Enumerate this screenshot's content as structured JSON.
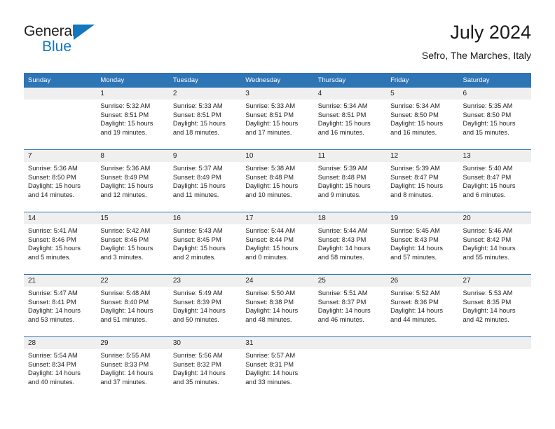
{
  "logo": {
    "primary_text": "General",
    "secondary_text": "Blue",
    "triangle_icon": "blue-triangle-icon",
    "primary_color": "#231f20",
    "accent_color": "#1277bc"
  },
  "header": {
    "title": "July 2024",
    "subtitle": "Sefro, The Marches, Italy"
  },
  "theme": {
    "header_blue": "#2e75b6",
    "day_band_gray": "#efefef",
    "text_color": "#222222"
  },
  "calendar": {
    "weekday_headers": [
      "Sunday",
      "Monday",
      "Tuesday",
      "Wednesday",
      "Thursday",
      "Friday",
      "Saturday"
    ],
    "weeks": [
      [
        {
          "day": "",
          "empty": true
        },
        {
          "day": "1",
          "sunrise": "Sunrise: 5:32 AM",
          "sunset": "Sunset: 8:51 PM",
          "daylight_line1": "Daylight: 15 hours",
          "daylight_line2": "and 19 minutes."
        },
        {
          "day": "2",
          "sunrise": "Sunrise: 5:33 AM",
          "sunset": "Sunset: 8:51 PM",
          "daylight_line1": "Daylight: 15 hours",
          "daylight_line2": "and 18 minutes."
        },
        {
          "day": "3",
          "sunrise": "Sunrise: 5:33 AM",
          "sunset": "Sunset: 8:51 PM",
          "daylight_line1": "Daylight: 15 hours",
          "daylight_line2": "and 17 minutes."
        },
        {
          "day": "4",
          "sunrise": "Sunrise: 5:34 AM",
          "sunset": "Sunset: 8:51 PM",
          "daylight_line1": "Daylight: 15 hours",
          "daylight_line2": "and 16 minutes."
        },
        {
          "day": "5",
          "sunrise": "Sunrise: 5:34 AM",
          "sunset": "Sunset: 8:50 PM",
          "daylight_line1": "Daylight: 15 hours",
          "daylight_line2": "and 16 minutes."
        },
        {
          "day": "6",
          "sunrise": "Sunrise: 5:35 AM",
          "sunset": "Sunset: 8:50 PM",
          "daylight_line1": "Daylight: 15 hours",
          "daylight_line2": "and 15 minutes."
        }
      ],
      [
        {
          "day": "7",
          "sunrise": "Sunrise: 5:36 AM",
          "sunset": "Sunset: 8:50 PM",
          "daylight_line1": "Daylight: 15 hours",
          "daylight_line2": "and 14 minutes."
        },
        {
          "day": "8",
          "sunrise": "Sunrise: 5:36 AM",
          "sunset": "Sunset: 8:49 PM",
          "daylight_line1": "Daylight: 15 hours",
          "daylight_line2": "and 12 minutes."
        },
        {
          "day": "9",
          "sunrise": "Sunrise: 5:37 AM",
          "sunset": "Sunset: 8:49 PM",
          "daylight_line1": "Daylight: 15 hours",
          "daylight_line2": "and 11 minutes."
        },
        {
          "day": "10",
          "sunrise": "Sunrise: 5:38 AM",
          "sunset": "Sunset: 8:48 PM",
          "daylight_line1": "Daylight: 15 hours",
          "daylight_line2": "and 10 minutes."
        },
        {
          "day": "11",
          "sunrise": "Sunrise: 5:39 AM",
          "sunset": "Sunset: 8:48 PM",
          "daylight_line1": "Daylight: 15 hours",
          "daylight_line2": "and 9 minutes."
        },
        {
          "day": "12",
          "sunrise": "Sunrise: 5:39 AM",
          "sunset": "Sunset: 8:47 PM",
          "daylight_line1": "Daylight: 15 hours",
          "daylight_line2": "and 8 minutes."
        },
        {
          "day": "13",
          "sunrise": "Sunrise: 5:40 AM",
          "sunset": "Sunset: 8:47 PM",
          "daylight_line1": "Daylight: 15 hours",
          "daylight_line2": "and 6 minutes."
        }
      ],
      [
        {
          "day": "14",
          "sunrise": "Sunrise: 5:41 AM",
          "sunset": "Sunset: 8:46 PM",
          "daylight_line1": "Daylight: 15 hours",
          "daylight_line2": "and 5 minutes."
        },
        {
          "day": "15",
          "sunrise": "Sunrise: 5:42 AM",
          "sunset": "Sunset: 8:46 PM",
          "daylight_line1": "Daylight: 15 hours",
          "daylight_line2": "and 3 minutes."
        },
        {
          "day": "16",
          "sunrise": "Sunrise: 5:43 AM",
          "sunset": "Sunset: 8:45 PM",
          "daylight_line1": "Daylight: 15 hours",
          "daylight_line2": "and 2 minutes."
        },
        {
          "day": "17",
          "sunrise": "Sunrise: 5:44 AM",
          "sunset": "Sunset: 8:44 PM",
          "daylight_line1": "Daylight: 15 hours",
          "daylight_line2": "and 0 minutes."
        },
        {
          "day": "18",
          "sunrise": "Sunrise: 5:44 AM",
          "sunset": "Sunset: 8:43 PM",
          "daylight_line1": "Daylight: 14 hours",
          "daylight_line2": "and 58 minutes."
        },
        {
          "day": "19",
          "sunrise": "Sunrise: 5:45 AM",
          "sunset": "Sunset: 8:43 PM",
          "daylight_line1": "Daylight: 14 hours",
          "daylight_line2": "and 57 minutes."
        },
        {
          "day": "20",
          "sunrise": "Sunrise: 5:46 AM",
          "sunset": "Sunset: 8:42 PM",
          "daylight_line1": "Daylight: 14 hours",
          "daylight_line2": "and 55 minutes."
        }
      ],
      [
        {
          "day": "21",
          "sunrise": "Sunrise: 5:47 AM",
          "sunset": "Sunset: 8:41 PM",
          "daylight_line1": "Daylight: 14 hours",
          "daylight_line2": "and 53 minutes."
        },
        {
          "day": "22",
          "sunrise": "Sunrise: 5:48 AM",
          "sunset": "Sunset: 8:40 PM",
          "daylight_line1": "Daylight: 14 hours",
          "daylight_line2": "and 51 minutes."
        },
        {
          "day": "23",
          "sunrise": "Sunrise: 5:49 AM",
          "sunset": "Sunset: 8:39 PM",
          "daylight_line1": "Daylight: 14 hours",
          "daylight_line2": "and 50 minutes."
        },
        {
          "day": "24",
          "sunrise": "Sunrise: 5:50 AM",
          "sunset": "Sunset: 8:38 PM",
          "daylight_line1": "Daylight: 14 hours",
          "daylight_line2": "and 48 minutes."
        },
        {
          "day": "25",
          "sunrise": "Sunrise: 5:51 AM",
          "sunset": "Sunset: 8:37 PM",
          "daylight_line1": "Daylight: 14 hours",
          "daylight_line2": "and 46 minutes."
        },
        {
          "day": "26",
          "sunrise": "Sunrise: 5:52 AM",
          "sunset": "Sunset: 8:36 PM",
          "daylight_line1": "Daylight: 14 hours",
          "daylight_line2": "and 44 minutes."
        },
        {
          "day": "27",
          "sunrise": "Sunrise: 5:53 AM",
          "sunset": "Sunset: 8:35 PM",
          "daylight_line1": "Daylight: 14 hours",
          "daylight_line2": "and 42 minutes."
        }
      ],
      [
        {
          "day": "28",
          "sunrise": "Sunrise: 5:54 AM",
          "sunset": "Sunset: 8:34 PM",
          "daylight_line1": "Daylight: 14 hours",
          "daylight_line2": "and 40 minutes."
        },
        {
          "day": "29",
          "sunrise": "Sunrise: 5:55 AM",
          "sunset": "Sunset: 8:33 PM",
          "daylight_line1": "Daylight: 14 hours",
          "daylight_line2": "and 37 minutes."
        },
        {
          "day": "30",
          "sunrise": "Sunrise: 5:56 AM",
          "sunset": "Sunset: 8:32 PM",
          "daylight_line1": "Daylight: 14 hours",
          "daylight_line2": "and 35 minutes."
        },
        {
          "day": "31",
          "sunrise": "Sunrise: 5:57 AM",
          "sunset": "Sunset: 8:31 PM",
          "daylight_line1": "Daylight: 14 hours",
          "daylight_line2": "and 33 minutes."
        },
        {
          "day": "",
          "empty": true
        },
        {
          "day": "",
          "empty": true
        },
        {
          "day": "",
          "empty": true
        }
      ]
    ]
  }
}
